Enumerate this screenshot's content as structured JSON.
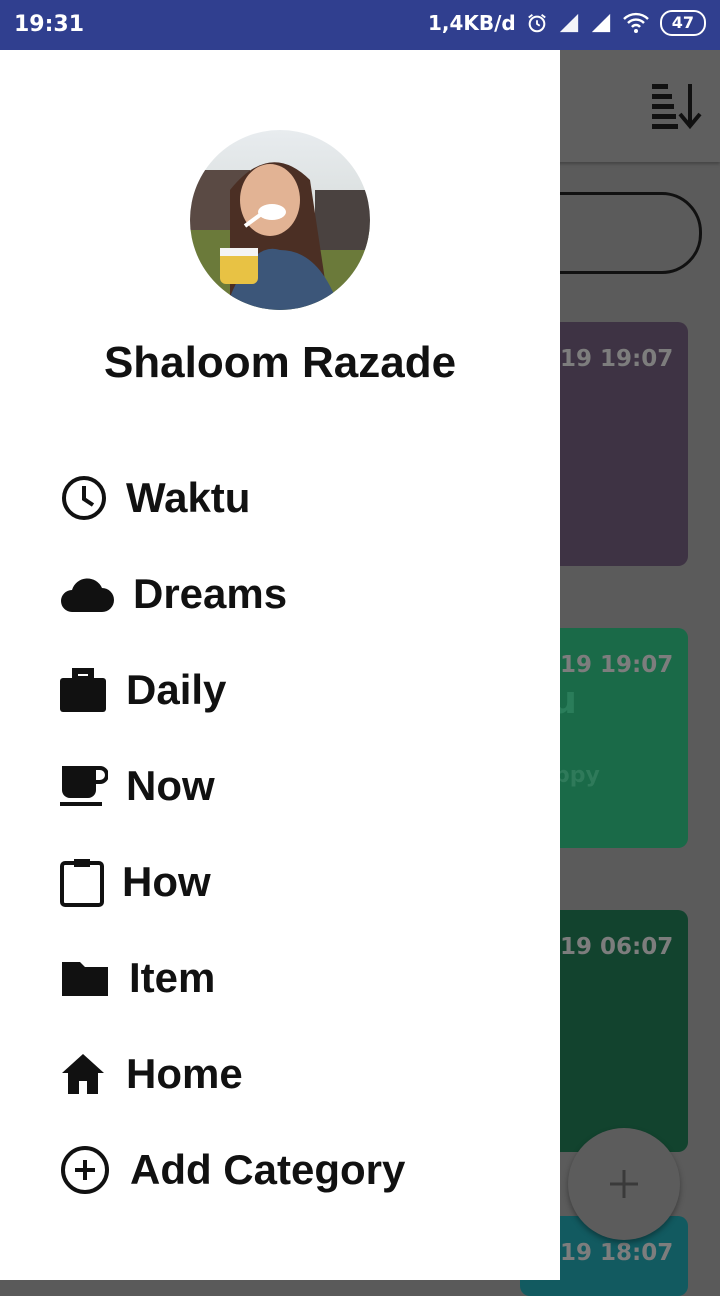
{
  "status": {
    "time": "19:31",
    "speed": "1,4KB/d",
    "battery": "47"
  },
  "profile": {
    "name": "Shaloom Razade"
  },
  "menu": [
    {
      "label": "Waktu",
      "icon": "clock-icon"
    },
    {
      "label": "Dreams",
      "icon": "cloud-icon"
    },
    {
      "label": "Daily",
      "icon": "briefcase-icon"
    },
    {
      "label": "Now",
      "icon": "coffee-icon"
    },
    {
      "label": "How",
      "icon": "clipboard-icon"
    },
    {
      "label": "Item",
      "icon": "folder-icon"
    },
    {
      "label": "Home",
      "icon": "home-icon"
    },
    {
      "label": "Add Category",
      "icon": "add-circle-icon"
    }
  ],
  "background": {
    "cards": [
      {
        "date": "19 19:07",
        "title": "",
        "sub": "",
        "color": "#3e3344"
      },
      {
        "date": "19 19:07",
        "title": "u",
        "sub": "ppy",
        "color": "#1a6a48"
      },
      {
        "date": "19 06:07",
        "title": "",
        "sub": "",
        "color": "#12432e"
      },
      {
        "date": "19 18:07",
        "title": "",
        "sub": "",
        "color": "#125a60"
      }
    ]
  },
  "colors": {
    "statusbar": "#303f8f",
    "drawer": "#ffffff",
    "scrim": "#5b5b5b"
  }
}
